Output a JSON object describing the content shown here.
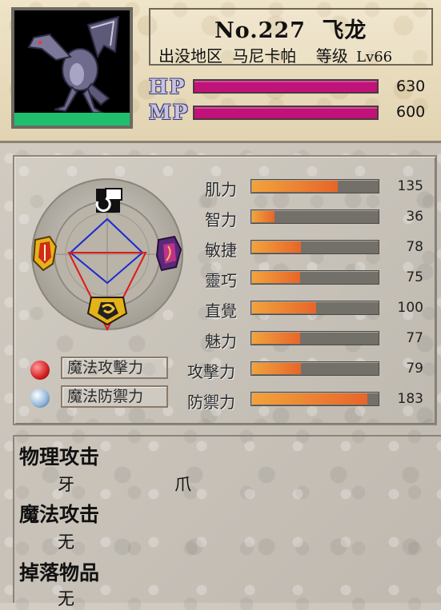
{
  "monster": {
    "number": "No.227",
    "name": "飞龙",
    "area_label": "出没地区",
    "area": "马尼卡帕",
    "level_label": "等级",
    "level": "Lv66"
  },
  "vitals": {
    "hp_label": "HP",
    "hp": "630",
    "hp_fill": 1.0,
    "mp_label": "MP",
    "mp": "600",
    "mp_fill": 1.0,
    "bar_color": "#c1127a"
  },
  "stats": [
    {
      "label": "肌力",
      "value": "135",
      "fill": 0.68
    },
    {
      "label": "智力",
      "value": "36",
      "fill": 0.18
    },
    {
      "label": "敏捷",
      "value": "78",
      "fill": 0.39
    },
    {
      "label": "靈巧",
      "value": "75",
      "fill": 0.38
    },
    {
      "label": "直覺",
      "value": "100",
      "fill": 0.51
    },
    {
      "label": "魅力",
      "value": "77",
      "fill": 0.38
    },
    {
      "label": "攻擊力",
      "value": "79",
      "fill": 0.39
    },
    {
      "label": "防禦力",
      "value": "183",
      "fill": 0.92
    }
  ],
  "magic": {
    "attack_label": "魔法攻擊力",
    "defense_label": "魔法防禦力",
    "attack_orb_color": "#d42020",
    "defense_orb_color": "#8fb4d8"
  },
  "wheel": {
    "icons": [
      "top-emblem-icon",
      "fire-emblem-icon",
      "magic-emblem-icon",
      "spiral-emblem-icon"
    ]
  },
  "info": {
    "physical_title": "物理攻击",
    "physical_items": [
      "牙",
      "爪"
    ],
    "magic_title": "魔法攻击",
    "magic_items": [
      "无"
    ],
    "drop_title": "掉落物品",
    "drop_items": [
      "无"
    ]
  }
}
